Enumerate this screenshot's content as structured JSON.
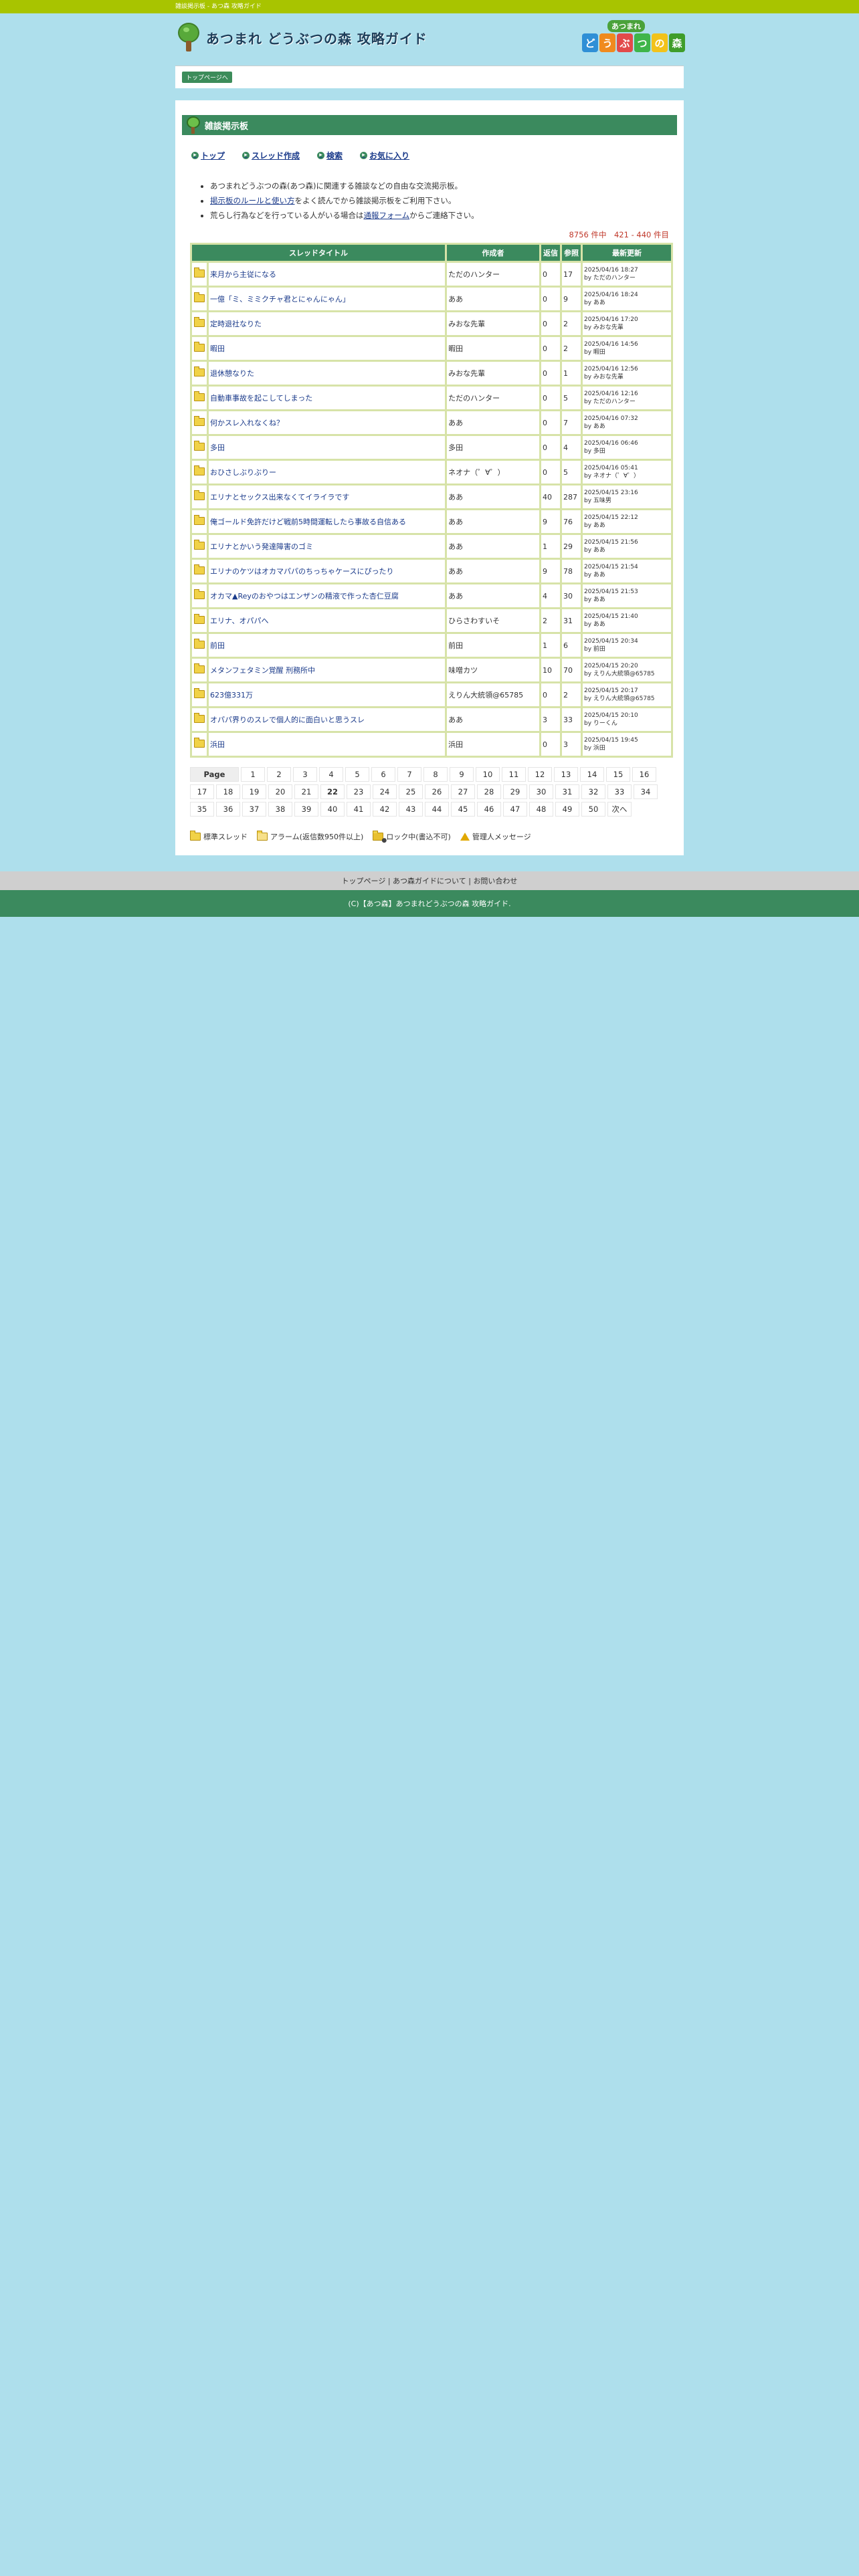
{
  "topbar": {
    "text": "雑談掲示板 - あつ森 攻略ガイド"
  },
  "header": {
    "site_title": "あつまれ どうぶつの森 攻略ガイド",
    "badge_top": "あつまれ",
    "badge_tiles": [
      "ど",
      "う",
      "ぶ",
      "つ",
      "の",
      "森"
    ],
    "tile_colors": [
      "#2f8fd6",
      "#f08a1e",
      "#e24a4a",
      "#3fb54a",
      "#f2c21a",
      "#3f9d2a"
    ]
  },
  "nav": {
    "crumb": "トップページへ"
  },
  "board": {
    "title": "雑談掲示板",
    "menu": [
      {
        "label": "トップ"
      },
      {
        "label": "スレッド作成"
      },
      {
        "label": "検索"
      },
      {
        "label": "お気に入り"
      }
    ],
    "notes": {
      "n1": "あつまれどうぶつの森(あつ森)に関連する雑談などの自由な交流掲示板。",
      "n2_link": "掲示板のルールと使い方",
      "n2_rest": "をよく読んでから雑談掲示板をご利用下さい。",
      "n3_pre": "荒らし行為などを行っている人がいる場合は",
      "n3_link": "通報フォーム",
      "n3_post": "からご連絡下さい。"
    },
    "count": "8756 件中　421 - 440 件目",
    "columns": {
      "title": "スレッドタイトル",
      "author": "作成者",
      "reply": "返信",
      "views": "参照",
      "updated": "最新更新"
    },
    "rows": [
      {
        "title": "来月から主従になる",
        "author": "ただのハンター",
        "reply": "0",
        "views": "17",
        "date": "2025/04/16 18:27",
        "by": "by ただのハンター"
      },
      {
        "title": "一億「ミ、ミミクチャ君とにゃんにゃん」",
        "author": "ああ",
        "reply": "0",
        "views": "9",
        "date": "2025/04/16 18:24",
        "by": "by ああ"
      },
      {
        "title": "定時退社なりた",
        "author": "みおな先輩",
        "reply": "0",
        "views": "2",
        "date": "2025/04/16 17:20",
        "by": "by みおな先輩"
      },
      {
        "title": "暇田",
        "author": "暇田",
        "reply": "0",
        "views": "2",
        "date": "2025/04/16 14:56",
        "by": "by 暇田"
      },
      {
        "title": "退休憩なりた",
        "author": "みおな先輩",
        "reply": "0",
        "views": "1",
        "date": "2025/04/16 12:56",
        "by": "by みおな先輩"
      },
      {
        "title": "自動車事故を起こしてしまった",
        "author": "ただのハンター",
        "reply": "0",
        "views": "5",
        "date": "2025/04/16 12:16",
        "by": "by ただのハンター"
      },
      {
        "title": "何かスレ入れなくね？",
        "author": "ああ",
        "reply": "0",
        "views": "7",
        "date": "2025/04/16 07:32",
        "by": "by ああ"
      },
      {
        "title": "多田",
        "author": "多田",
        "reply": "0",
        "views": "4",
        "date": "2025/04/16 06:46",
        "by": "by 多田"
      },
      {
        "title": "おひさしぶりぶりー",
        "author": "ネオナ（゜∀゜）",
        "reply": "0",
        "views": "5",
        "date": "2025/04/16 05:41",
        "by": "by ネオナ（゜∀゜）"
      },
      {
        "title": "エリナとセックス出来なくてイライラです",
        "author": "ああ",
        "reply": "40",
        "views": "287",
        "date": "2025/04/15 23:16",
        "by": "by 五味男"
      },
      {
        "title": "俺ゴールド免許だけど戦前5時間運転したら事故る自信ある",
        "author": "ああ",
        "reply": "9",
        "views": "76",
        "date": "2025/04/15 22:12",
        "by": "by ああ"
      },
      {
        "title": "エリナとかいう発達障害のゴミ",
        "author": "ああ",
        "reply": "1",
        "views": "29",
        "date": "2025/04/15 21:56",
        "by": "by ああ"
      },
      {
        "title": "エリナのケツはオカマパパのちっちゃケースにぴったり",
        "author": "ああ",
        "reply": "9",
        "views": "78",
        "date": "2025/04/15 21:54",
        "by": "by ああ"
      },
      {
        "title": "オカマ▲Reyのおやつはエンザンの精液で作った杏仁豆腐",
        "author": "ああ",
        "reply": "4",
        "views": "30",
        "date": "2025/04/15 21:53",
        "by": "by ああ"
      },
      {
        "title": "エリナ、オパパへ",
        "author": "ひらさわすいそ",
        "reply": "2",
        "views": "31",
        "date": "2025/04/15 21:40",
        "by": "by ああ"
      },
      {
        "title": "前田",
        "author": "前田",
        "reply": "1",
        "views": "6",
        "date": "2025/04/15 20:34",
        "by": "by 前田"
      },
      {
        "title": "メタンフェタミン覚醒 刑務所中",
        "author": "味噌カツ",
        "reply": "10",
        "views": "70",
        "date": "2025/04/15 20:20",
        "by": "by えりん大統領@65785"
      },
      {
        "title": "623億331万",
        "author": "えりん大統領@65785",
        "reply": "0",
        "views": "2",
        "date": "2025/04/15 20:17",
        "by": "by えりん大統領@65785"
      },
      {
        "title": "オパパ界りのスレで個人的に面白いと思うスレ",
        "author": "ああ",
        "reply": "3",
        "views": "33",
        "date": "2025/04/15 20:10",
        "by": "by りーくん"
      },
      {
        "title": "浜田",
        "author": "浜田",
        "reply": "0",
        "views": "3",
        "date": "2025/04/15 19:45",
        "by": "by 浜田"
      }
    ],
    "pager": {
      "label": "Page",
      "pages": [
        "1",
        "2",
        "3",
        "4",
        "5",
        "6",
        "7",
        "8",
        "9",
        "10",
        "11",
        "12",
        "13",
        "14",
        "15",
        "16",
        "17",
        "18",
        "19",
        "20",
        "21",
        "22",
        "23",
        "24",
        "25",
        "26",
        "27",
        "28",
        "29",
        "30",
        "31",
        "32",
        "33",
        "34",
        "35",
        "36",
        "37",
        "38",
        "39",
        "40",
        "41",
        "42",
        "43",
        "44",
        "45",
        "46",
        "47",
        "48",
        "49",
        "50"
      ],
      "current": "22",
      "next": "次へ"
    },
    "legend": {
      "normal": "標準スレッド",
      "alarm": "アラーム(返信数950件以上)",
      "lock": "ロック中(書込不可)",
      "admin": "管理人メッセージ"
    }
  },
  "footer": {
    "link1": "トップページ",
    "link2": "あつ森ガイドについて",
    "link3": "お問い合わせ",
    "sep": "|",
    "copyright": "(C)【あつ森】あつまれどうぶつの森 攻略ガイド."
  }
}
